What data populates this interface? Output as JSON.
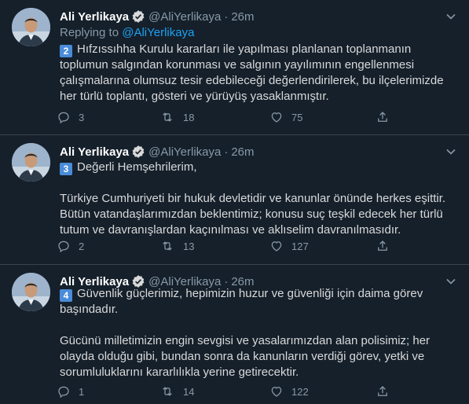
{
  "tweets": [
    {
      "name": "Ali Yerlikaya",
      "handle": "@AliYerlikaya",
      "dot": "·",
      "time": "26m",
      "replying_prefix": "Replying to ",
      "replying_to": "@AliYerlikaya",
      "number": "2",
      "paragraphs": [
        "Hıfzıssıhha Kurulu kararları ile yapılması planlanan toplanmanın toplumun salgından korunması ve salgının yayılımının engellenmesi çalışmalarına olumsuz tesir edebileceği değerlendirilerek, bu ilçelerimizde her türlü toplantı, gösteri ve yürüyüş yasaklanmıştır."
      ],
      "replies": "3",
      "retweets": "18",
      "likes": "75"
    },
    {
      "name": "Ali Yerlikaya",
      "handle": "@AliYerlikaya",
      "dot": "·",
      "time": "26m",
      "number": "3",
      "paragraphs": [
        "Değerli Hemşehrilerim,",
        "Türkiye Cumhuriyeti bir hukuk devletidir ve kanunlar önünde herkes eşittir. Bütün vatandaşlarımızdan beklentimiz; konusu suç teşkil edecek her türlü tutum ve davranışlardan kaçınılması ve aklıselim davranılmasıdır."
      ],
      "replies": "2",
      "retweets": "13",
      "likes": "127"
    },
    {
      "name": "Ali Yerlikaya",
      "handle": "@AliYerlikaya",
      "dot": "·",
      "time": "26m",
      "number": "4",
      "paragraphs": [
        "Güvenlik güçlerimiz, hepimizin huzur ve güvenliği için daima görev başındadır.",
        "Gücünü milletimizin engin sevgisi ve yasalarımızdan alan polisimiz; her olayda olduğu gibi, bundan sonra da kanunların verdiği görev, yetki ve sorumluluklarını kararlılıkla yerine getirecektir."
      ],
      "replies": "1",
      "retweets": "14",
      "likes": "122"
    }
  ],
  "icons": {
    "verified": "verified-badge-icon",
    "caret": "chevron-down-icon",
    "reply": "reply-icon",
    "retweet": "retweet-icon",
    "like": "heart-icon",
    "share": "share-icon"
  },
  "colors": {
    "background": "#15202b",
    "divider": "#38444d",
    "text": "#d9d9d9",
    "muted": "#8899a6",
    "accent": "#1da1f2",
    "number_badge": "#4a8cd9"
  }
}
